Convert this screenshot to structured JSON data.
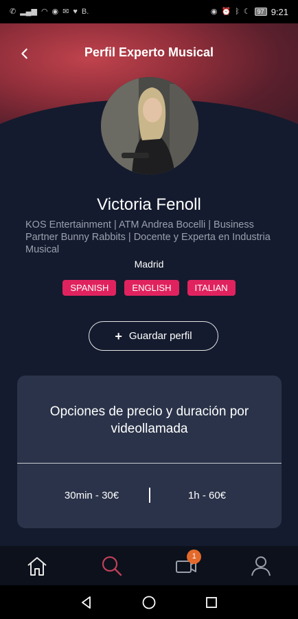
{
  "status_bar": {
    "time": "9:21",
    "battery": "97",
    "left_icons": [
      "phone-icon",
      "signal-icon",
      "wifi-icon",
      "whatsapp-icon",
      "gmail-icon",
      "heart-icon",
      "b-icon"
    ],
    "right_icons": [
      "eye-icon",
      "alarm-icon",
      "bluetooth-icon",
      "moon-icon"
    ]
  },
  "header": {
    "title": "Perfil Experto Musical"
  },
  "profile": {
    "name": "Victoria Fenoll",
    "bio": "KOS Entertainment | ATM Andrea Bocelli | Business Partner Bunny Rabbits | Docente y Experta en Industria Musical",
    "city": "Madrid",
    "languages": [
      "SPANISH",
      "ENGLISH",
      "ITALIAN"
    ]
  },
  "actions": {
    "save_label": "Guardar perfil"
  },
  "pricing": {
    "title": "Opciones de precio y duración por videollamada",
    "options": [
      "30min - 30€",
      "1h - 60€"
    ]
  },
  "bottom_nav": {
    "items": [
      "home-icon",
      "search-icon",
      "video-call-icon",
      "profile-icon"
    ],
    "active": "search-icon",
    "video_badge": "1"
  },
  "colors": {
    "background": "#141b2e",
    "accent_pink": "#e0235f",
    "search_active": "#c0405a",
    "badge_orange": "#e36a2c",
    "card": "#2a3349"
  }
}
